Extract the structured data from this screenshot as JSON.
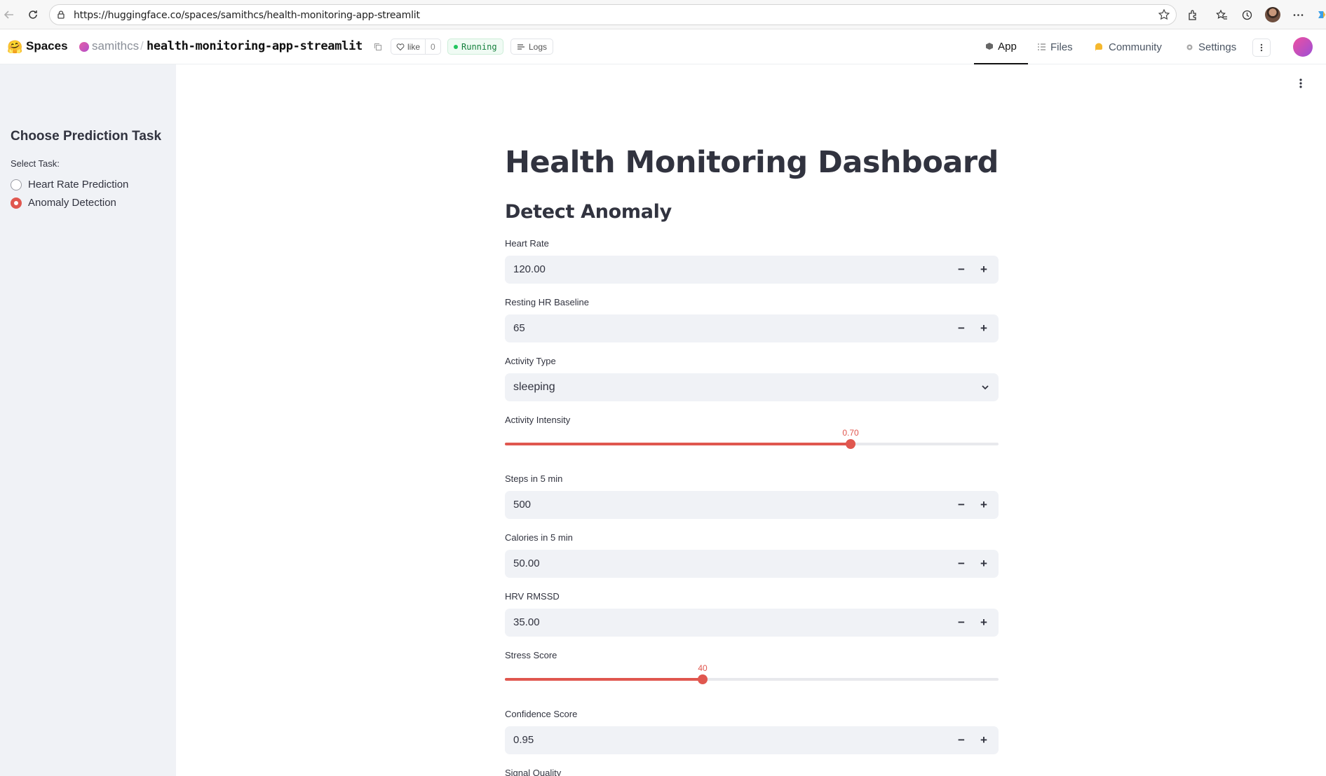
{
  "browser": {
    "url": "https://huggingface.co/spaces/samithcs/health-monitoring-app-streamlit"
  },
  "hf_header": {
    "spaces_label": "Spaces",
    "owner": "samithcs",
    "separator": "/",
    "repo": "health-monitoring-app-streamlit",
    "like_label": "like",
    "like_count": "0",
    "status": "Running",
    "logs_label": "Logs",
    "tabs": [
      {
        "label": "App",
        "icon": "cube-icon",
        "active": true
      },
      {
        "label": "Files",
        "icon": "files-icon",
        "active": false
      },
      {
        "label": "Community",
        "icon": "community-icon",
        "active": false
      },
      {
        "label": "Settings",
        "icon": "gear-icon",
        "active": false
      }
    ]
  },
  "sidebar": {
    "title": "Choose Prediction Task",
    "select_label": "Select Task:",
    "options": [
      {
        "label": "Heart Rate Prediction",
        "selected": false
      },
      {
        "label": "Anomaly Detection",
        "selected": true
      }
    ]
  },
  "main": {
    "title": "Health Monitoring Dashboard",
    "subheader": "Detect Anomaly",
    "heart_rate": {
      "label": "Heart Rate",
      "value": "120.00"
    },
    "resting_hr": {
      "label": "Resting HR Baseline",
      "value": "65"
    },
    "activity_type": {
      "label": "Activity Type",
      "value": "sleeping"
    },
    "activity_intensity": {
      "label": "Activity Intensity",
      "value": "0.70",
      "fraction": 0.7
    },
    "steps": {
      "label": "Steps in 5 min",
      "value": "500"
    },
    "calories": {
      "label": "Calories in 5 min",
      "value": "50.00"
    },
    "hrv": {
      "label": "HRV RMSSD",
      "value": "35.00"
    },
    "stress": {
      "label": "Stress Score",
      "value": "40",
      "fraction": 0.4
    },
    "confidence": {
      "label": "Confidence Score",
      "value": "0.95"
    },
    "signal_quality": {
      "label": "Signal Quality"
    },
    "stepper_minus": "−",
    "stepper_plus": "+"
  },
  "colors": {
    "accent": "#e0574f",
    "sidebar_bg": "#f0f2f6",
    "input_bg": "#f0f2f6",
    "running_green": "#22c55e"
  }
}
